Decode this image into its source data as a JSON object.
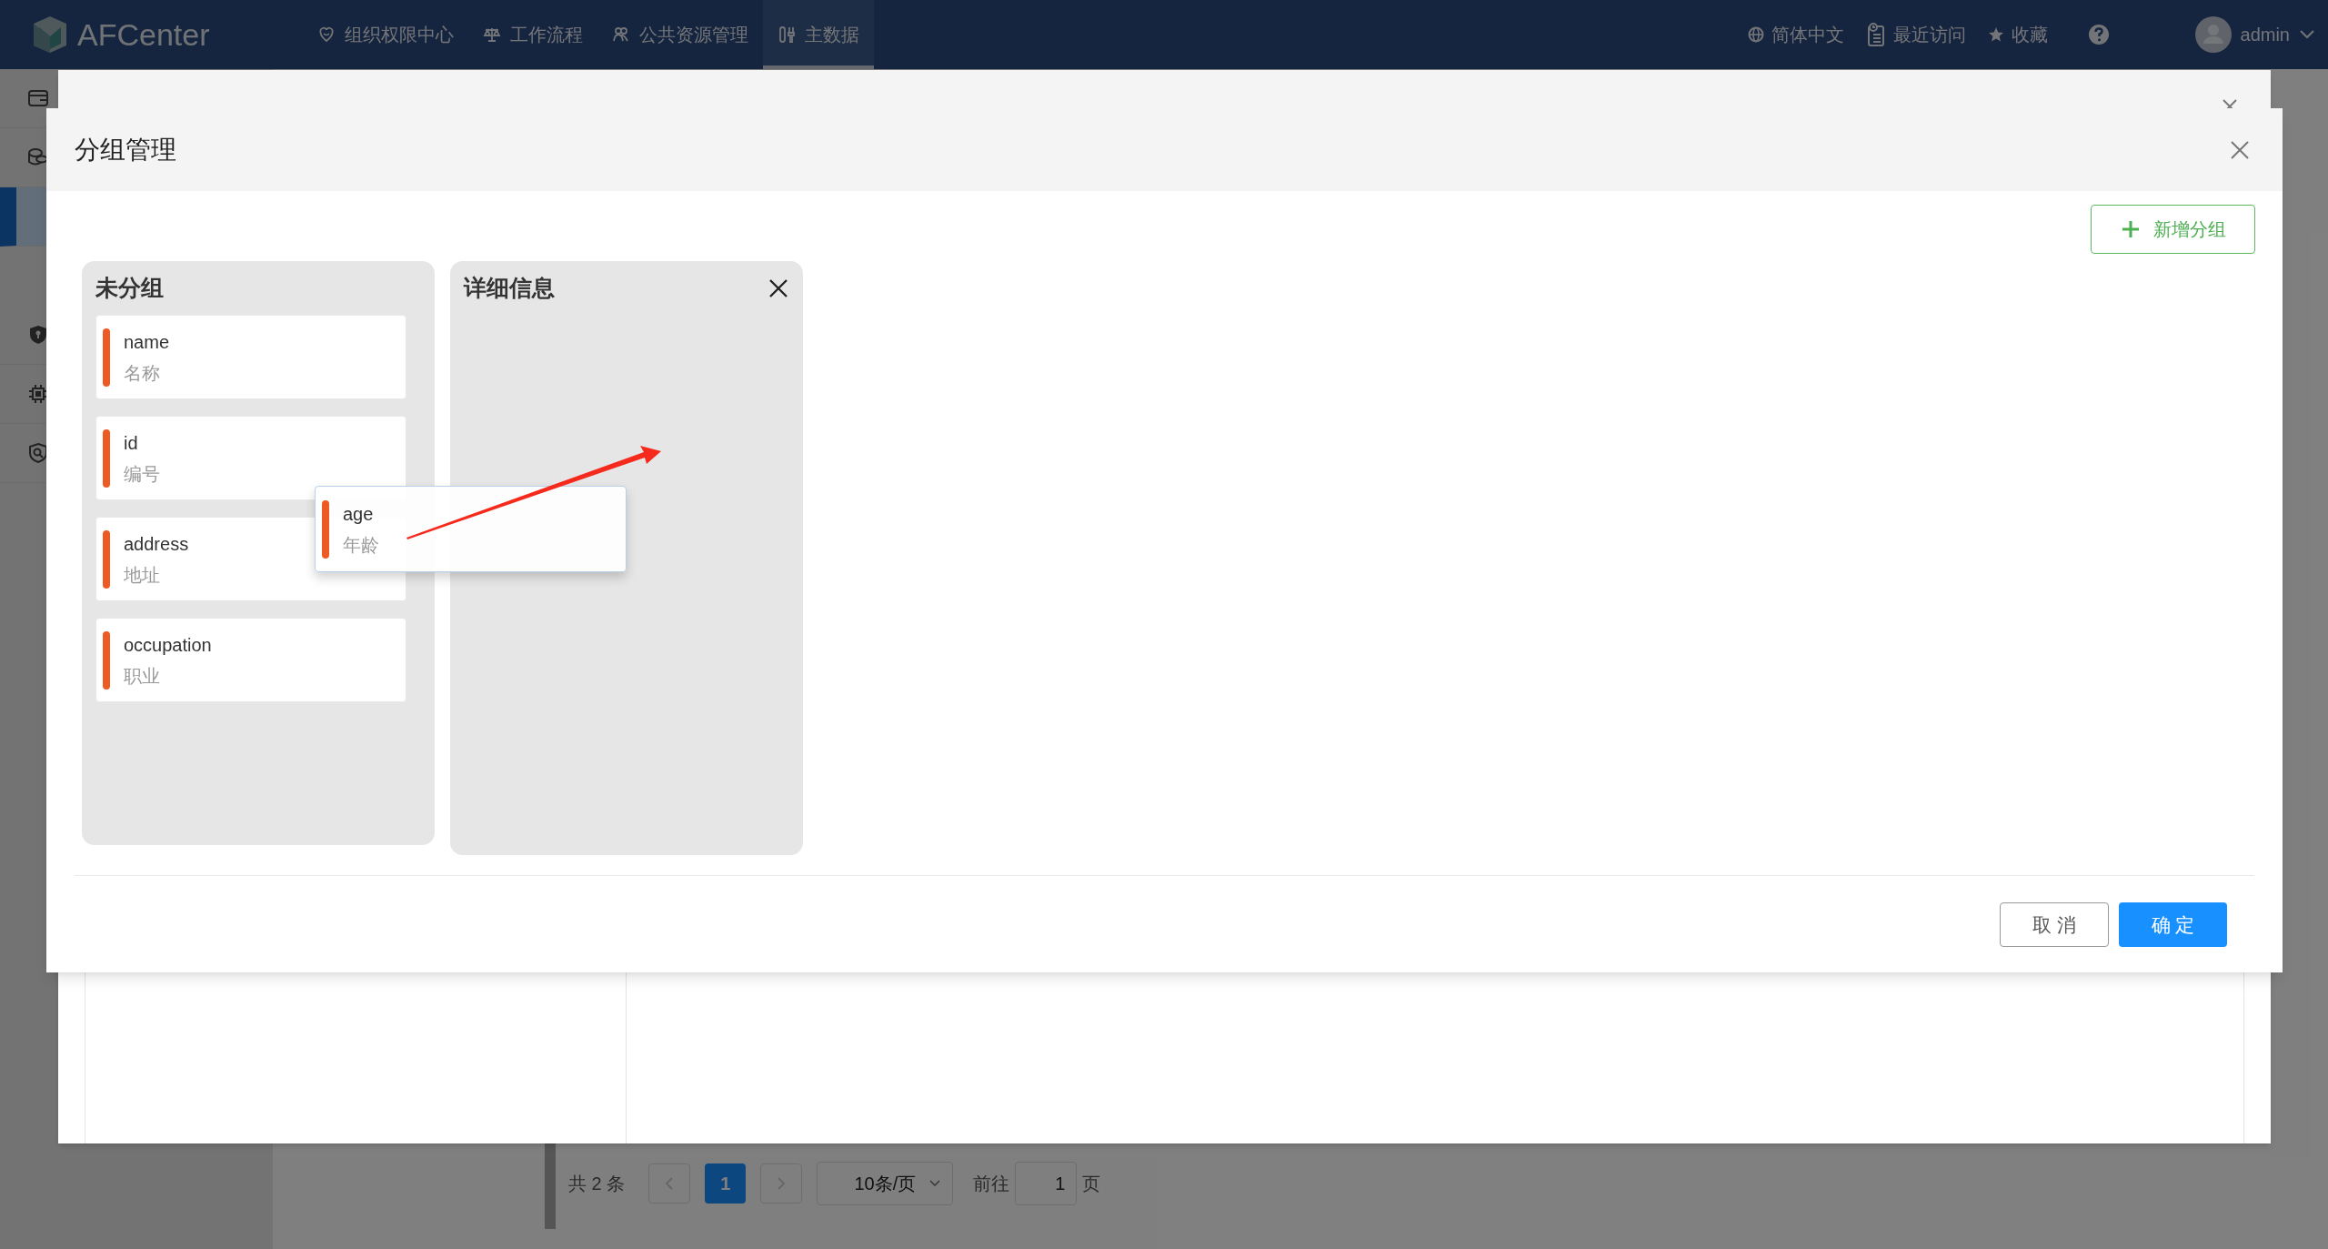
{
  "top_bar": {
    "logo_text": "AFCenter",
    "nav": [
      {
        "label": "组织权限中心",
        "selected": false
      },
      {
        "label": "工作流程",
        "selected": false
      },
      {
        "label": "公共资源管理",
        "selected": false
      },
      {
        "label": "主数据",
        "selected": true
      }
    ],
    "language": "简体中文",
    "recent": "最近访问",
    "favorites": "收藏",
    "user": "admin"
  },
  "sidebar": {
    "groups": [
      {
        "items": [
          {
            "selected": false
          },
          {
            "selected": false
          },
          {
            "selected": true
          }
        ]
      },
      {
        "items": [
          {
            "selected": false
          },
          {
            "selected": false
          },
          {
            "selected": false
          }
        ]
      }
    ]
  },
  "pagination": {
    "total": "共 2 条",
    "pages": [
      {
        "label": "1",
        "selected": true
      }
    ],
    "page_size": "10条/页",
    "goto_label": "前往",
    "goto_value": "1",
    "goto_suffix": "页"
  },
  "group_dialog": {
    "title": "分组管理",
    "add_button": "新增分组",
    "columns": [
      {
        "title": "未分组",
        "closable": false,
        "fields": [
          {
            "name": "name",
            "label": "名称"
          },
          {
            "name": "id",
            "label": "编号"
          },
          {
            "name": "address",
            "label": "地址"
          },
          {
            "name": "occupation",
            "label": "职业"
          }
        ]
      },
      {
        "title": "详细信息",
        "closable": true
      }
    ],
    "dragging_field": {
      "name": "age",
      "label": "年龄"
    },
    "cancel_button": "取 消",
    "confirm_button": "确 定"
  }
}
